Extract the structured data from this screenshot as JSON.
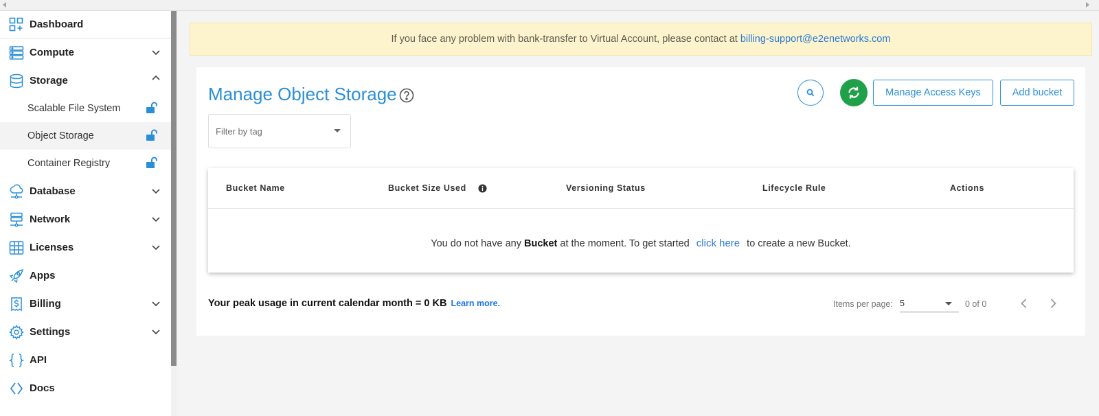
{
  "sidebar": {
    "items": [
      {
        "label": "Dashboard",
        "icon": "dashboard-icon",
        "chevron": "none"
      },
      {
        "label": "Compute",
        "icon": "compute-icon",
        "chevron": "down"
      },
      {
        "label": "Storage",
        "icon": "storage-icon",
        "chevron": "up"
      },
      {
        "label": "Database",
        "icon": "database-icon",
        "chevron": "down"
      },
      {
        "label": "Network",
        "icon": "network-icon",
        "chevron": "down"
      },
      {
        "label": "Licenses",
        "icon": "licenses-icon",
        "chevron": "down"
      },
      {
        "label": "Apps",
        "icon": "apps-rocket-icon",
        "chevron": "none"
      },
      {
        "label": "Billing",
        "icon": "billing-icon",
        "chevron": "down"
      },
      {
        "label": "Settings",
        "icon": "settings-gear-icon",
        "chevron": "down"
      },
      {
        "label": "API",
        "icon": "api-braces-icon",
        "chevron": "none"
      },
      {
        "label": "Docs",
        "icon": "docs-code-icon",
        "chevron": "none"
      }
    ],
    "storage_sub": [
      {
        "label": "Scalable File System",
        "active": false
      },
      {
        "label": "Object Storage",
        "active": true
      },
      {
        "label": "Container Registry",
        "active": false
      }
    ]
  },
  "banner": {
    "text": "If you face any problem with bank-transfer to Virtual Account, please contact at",
    "email": "billing-support@e2enetworks.com"
  },
  "page": {
    "title": "Manage Object Storage",
    "manage_keys_label": "Manage Access Keys",
    "add_bucket_label": "Add bucket",
    "filter_placeholder": "Filter by tag"
  },
  "table": {
    "columns": [
      "Bucket Name",
      "Bucket Size Used",
      "Versioning Status",
      "Lifecycle Rule",
      "Actions"
    ],
    "empty_prefix": "You do not have any",
    "empty_bold": "Bucket",
    "empty_middle": "at the moment. To get started",
    "empty_link": "click here",
    "empty_suffix": "to create a new Bucket."
  },
  "footer": {
    "peak_text": "Your peak usage in current calendar month = 0 KB",
    "learn_more": "Learn more.",
    "items_per_page_label": "Items per page:",
    "items_per_page_value": "5",
    "range": "0 of 0"
  },
  "colors": {
    "accent": "#2a8fd6",
    "refresh_green": "#21a04a",
    "banner_bg": "#fdf3cd",
    "link": "#2a7ad8"
  }
}
